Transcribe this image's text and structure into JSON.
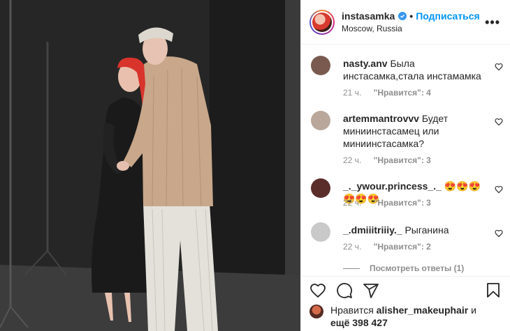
{
  "header": {
    "username": "instasamka",
    "follow_label": "Подписаться",
    "dot": "•",
    "location": "Moscow, Russia",
    "more_label": "•••"
  },
  "comments": [
    {
      "username": "nasty.anv",
      "text": "Была инстасамка,стала инстамамка",
      "time": "21 ч.",
      "likes": "\"Нравится\": 4",
      "avatar_color": "#7a5a4f"
    },
    {
      "username": "artemmantrovvv",
      "text": "Будет миниинстасамец или миниинстасамка?",
      "time": "22 ч.",
      "likes": "\"Нравится\": 3",
      "avatar_color": "#b8a79a"
    },
    {
      "username": "_._ywour.princess_._",
      "text": "😍😍😍😍😍😍",
      "time": "22 ч.",
      "likes": "\"Нравится\": 3",
      "avatar_color": "#5a2d2a"
    },
    {
      "username": "_.dmiiitriiiy._",
      "text": "Рыганина",
      "time": "22 ч.",
      "likes": "\"Нравится\": 2",
      "avatar_color": "#c9c9c9"
    }
  ],
  "view_replies_label": "Посмотреть ответы (1)",
  "likes": {
    "prefix": "Нравится",
    "user": "alisher_makeuphair",
    "conj": "и",
    "count": "ещё 398 427"
  },
  "icons": [
    "heart-icon",
    "comment-icon",
    "share-icon",
    "bookmark-icon",
    "verified-icon"
  ],
  "colors": {
    "accent": "#0095f6",
    "verified": "#3897f0",
    "muted": "#8e8e8e"
  }
}
